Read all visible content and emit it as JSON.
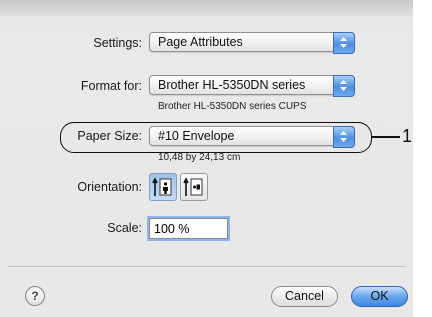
{
  "settings": {
    "label": "Settings:",
    "value": "Page Attributes"
  },
  "format_for": {
    "label": "Format for:",
    "value": "Brother HL-5350DN series",
    "detail": "Brother HL-5350DN series CUPS"
  },
  "paper_size": {
    "label": "Paper Size:",
    "value": "#10 Envelope",
    "detail": "10,48 by 24,13 cm"
  },
  "orientation": {
    "label": "Orientation:",
    "selected": "portrait",
    "options": [
      "portrait",
      "landscape"
    ]
  },
  "scale": {
    "label": "Scale:",
    "value": "100 %"
  },
  "callout": {
    "number": "1"
  },
  "buttons": {
    "help": "?",
    "cancel": "Cancel",
    "ok": "OK"
  },
  "colors": {
    "accent": "#4d8fe0",
    "window_bg": "#e8e8e8"
  }
}
